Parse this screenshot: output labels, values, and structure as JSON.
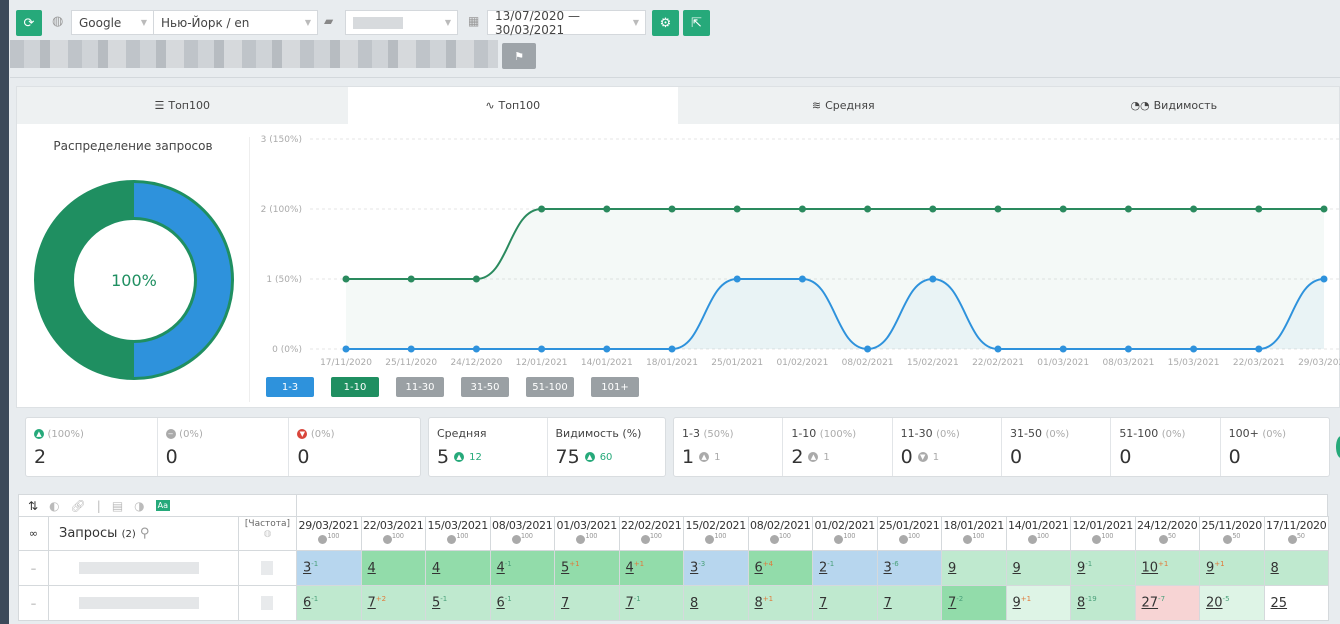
{
  "toolbar": {
    "engine": "Google",
    "region": "Нью-Йорк / en",
    "date_range": "13/07/2020 — 30/03/2021"
  },
  "tabs": [
    {
      "label": "Топ100",
      "icon": "layers-icon"
    },
    {
      "label": "Топ100",
      "icon": "pulse-icon",
      "active": true
    },
    {
      "label": "Средняя",
      "icon": "lines-icon"
    },
    {
      "label": "Видимость",
      "icon": "glasses-icon"
    }
  ],
  "donut": {
    "title": "Распределение запросов",
    "center": "100%",
    "blue_fraction": 0.5,
    "colors": {
      "blue": "#2e92dc",
      "green": "#1f8f61"
    }
  },
  "chart_data": {
    "type": "line",
    "x": [
      "17/11/2020",
      "25/11/2020",
      "24/12/2020",
      "12/01/2021",
      "14/01/2021",
      "18/01/2021",
      "25/01/2021",
      "01/02/2021",
      "08/02/2021",
      "15/02/2021",
      "22/02/2021",
      "01/03/2021",
      "08/03/2021",
      "15/03/2021",
      "22/03/2021",
      "29/03/2021"
    ],
    "yticks": [
      "0 (0%)",
      "1 (50%)",
      "2 (100%)",
      "3 (150%)"
    ],
    "ylim": [
      0,
      3
    ],
    "series": [
      {
        "name": "1-10",
        "color": "#2a8a5e",
        "values": [
          1,
          1,
          1,
          2,
          2,
          2,
          2,
          2,
          2,
          2,
          2,
          2,
          2,
          2,
          2,
          2
        ]
      },
      {
        "name": "1-3",
        "color": "#2e92dc",
        "values": [
          0,
          0,
          0,
          0,
          0,
          0,
          1,
          1,
          0,
          1,
          0,
          0,
          0,
          0,
          0,
          1
        ]
      }
    ],
    "legend": [
      {
        "label": "1-3",
        "color": "#2e92dc"
      },
      {
        "label": "1-10",
        "color": "#1f8f61"
      },
      {
        "label": "11-30",
        "color": "#9aa0a4"
      },
      {
        "label": "31-50",
        "color": "#9aa0a4"
      },
      {
        "label": "51-100",
        "color": "#9aa0a4"
      },
      {
        "label": "101+",
        "color": "#9aa0a4"
      }
    ]
  },
  "stats1": [
    {
      "pct": "(100%)",
      "value": "2",
      "icon": "arrow-up-circle-icon"
    },
    {
      "pct": "(0%)",
      "value": "0",
      "icon": "minus-circle-icon"
    },
    {
      "pct": "(0%)",
      "value": "0",
      "icon": "arrow-down-circle-icon"
    }
  ],
  "stats2": [
    {
      "label": "Средняя",
      "value": "5",
      "delta": "12"
    },
    {
      "label": "Видимость (%)",
      "value": "75",
      "delta": "60"
    }
  ],
  "stats3": [
    {
      "label": "1-3",
      "pct": "(50%)",
      "value": "1",
      "delta": "1",
      "dir": "up"
    },
    {
      "label": "1-10",
      "pct": "(100%)",
      "value": "2",
      "delta": "1",
      "dir": "up"
    },
    {
      "label": "11-30",
      "pct": "(0%)",
      "value": "0",
      "delta": "1",
      "dir": "down"
    },
    {
      "label": "31-50",
      "pct": "(0%)",
      "value": "0"
    },
    {
      "label": "51-100",
      "pct": "(0%)",
      "value": "0"
    },
    {
      "label": "100+",
      "pct": "(0%)",
      "value": "0"
    }
  ],
  "table": {
    "queries_label": "Запросы",
    "queries_count": "(2)",
    "freq_label": "[Частота]",
    "row_marker": "–",
    "dates": [
      {
        "d": "29/03/2021",
        "p": "100"
      },
      {
        "d": "22/03/2021",
        "p": "100"
      },
      {
        "d": "15/03/2021",
        "p": "100"
      },
      {
        "d": "08/03/2021",
        "p": "100"
      },
      {
        "d": "01/03/2021",
        "p": "100"
      },
      {
        "d": "22/02/2021",
        "p": "100"
      },
      {
        "d": "15/02/2021",
        "p": "100"
      },
      {
        "d": "08/02/2021",
        "p": "100"
      },
      {
        "d": "01/02/2021",
        "p": "100"
      },
      {
        "d": "25/01/2021",
        "p": "100"
      },
      {
        "d": "18/01/2021",
        "p": "100"
      },
      {
        "d": "14/01/2021",
        "p": "100"
      },
      {
        "d": "12/01/2021",
        "p": "100"
      },
      {
        "d": "24/12/2020",
        "p": "50"
      },
      {
        "d": "25/11/2020",
        "p": "50"
      },
      {
        "d": "17/11/2020",
        "p": "50"
      }
    ],
    "rows": [
      [
        {
          "v": "3",
          "c": "-1",
          "t": "blue"
        },
        {
          "v": "4",
          "t": "green"
        },
        {
          "v": "4",
          "t": "green"
        },
        {
          "v": "4",
          "c": "-1",
          "t": "green"
        },
        {
          "v": "5",
          "c": "+1",
          "t": "green"
        },
        {
          "v": "4",
          "c": "+1",
          "t": "green"
        },
        {
          "v": "3",
          "c": "-3",
          "t": "blue"
        },
        {
          "v": "6",
          "c": "+4",
          "t": "green"
        },
        {
          "v": "2",
          "c": "-1",
          "t": "blue"
        },
        {
          "v": "3",
          "c": "-6",
          "t": "blue"
        },
        {
          "v": "9",
          "t": "light"
        },
        {
          "v": "9",
          "t": "light"
        },
        {
          "v": "9",
          "c": "-1",
          "t": "light"
        },
        {
          "v": "10",
          "c": "+1",
          "t": "light"
        },
        {
          "v": "9",
          "c": "+1",
          "t": "light"
        },
        {
          "v": "8",
          "t": "light"
        }
      ],
      [
        {
          "v": "6",
          "c": "-1",
          "t": "light"
        },
        {
          "v": "7",
          "c": "+2",
          "t": "light"
        },
        {
          "v": "5",
          "c": "-1",
          "t": "light"
        },
        {
          "v": "6",
          "c": "-1",
          "t": "light"
        },
        {
          "v": "7",
          "t": "light"
        },
        {
          "v": "7",
          "c": "-1",
          "t": "light"
        },
        {
          "v": "8",
          "t": "light"
        },
        {
          "v": "8",
          "c": "+1",
          "t": "light"
        },
        {
          "v": "7",
          "t": "light"
        },
        {
          "v": "7",
          "t": "light"
        },
        {
          "v": "7",
          "c": "-2",
          "t": "green"
        },
        {
          "v": "9",
          "c": "+1",
          "t": "pale"
        },
        {
          "v": "8",
          "c": "-19",
          "t": "light"
        },
        {
          "v": "27",
          "c": "-7",
          "t": "pink"
        },
        {
          "v": "20",
          "c": "-5",
          "t": "pale"
        },
        {
          "v": "25",
          "t": "white"
        }
      ]
    ]
  }
}
